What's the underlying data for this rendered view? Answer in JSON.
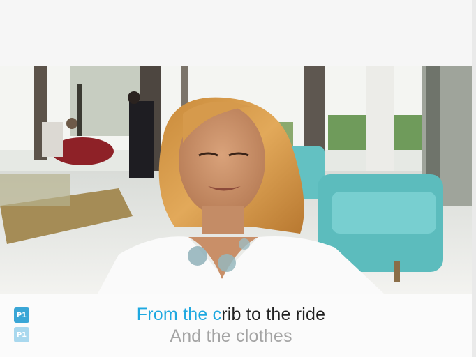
{
  "players": {
    "p1_label": "P1",
    "p2_label": "P1"
  },
  "lyrics": {
    "current_sung": "From the c",
    "current_unsung": "rib to the ride",
    "next_line": "And the clothes"
  },
  "colors": {
    "sung_highlight": "#1ea8e0",
    "unsung_text": "#222222",
    "next_line_text": "#a4a4a4",
    "badge_active": "#3aa6d6",
    "badge_inactive": "#a9d8ee"
  }
}
